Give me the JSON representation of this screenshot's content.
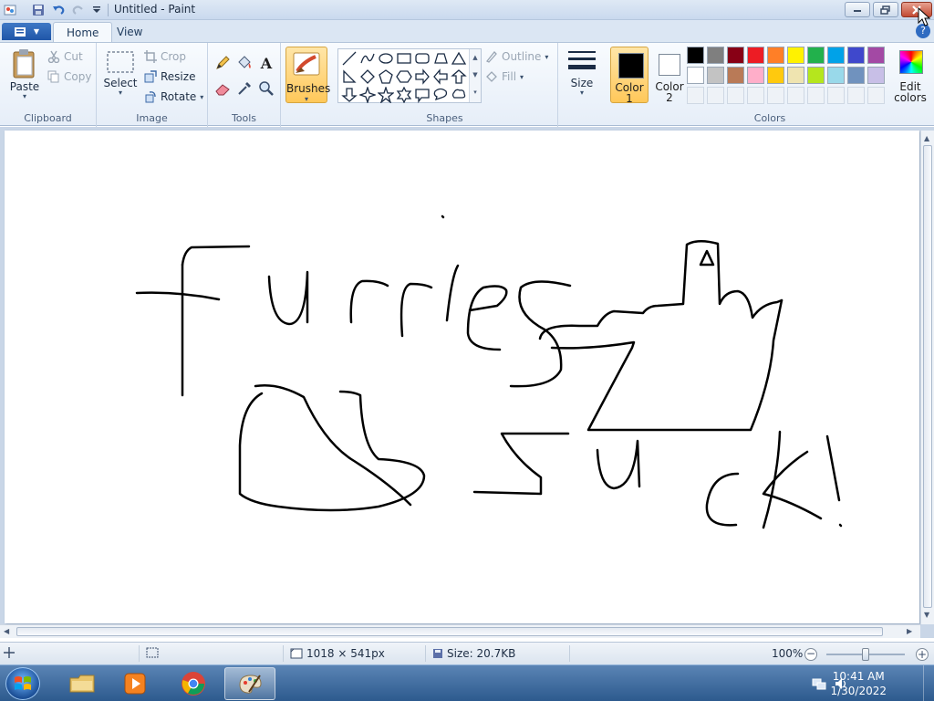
{
  "window": {
    "title": "Untitled - Paint"
  },
  "tabs": [
    {
      "label": "Home"
    },
    {
      "label": "View"
    }
  ],
  "clipboard": {
    "paste": "Paste",
    "cut": "Cut",
    "copy": "Copy",
    "group": "Clipboard"
  },
  "image": {
    "select": "Select",
    "crop": "Crop",
    "resize": "Resize",
    "rotate": "Rotate",
    "group": "Image"
  },
  "tools": {
    "group": "Tools"
  },
  "brushes": {
    "label": "Brushes"
  },
  "shapes": {
    "outline": "Outline",
    "fill": "Fill",
    "group": "Shapes"
  },
  "size": {
    "label": "Size"
  },
  "colors": {
    "color1": "Color\n1",
    "color2": "Color\n2",
    "color1_label_a": "Color",
    "color1_label_b": "1",
    "color2_label_a": "Color",
    "color2_label_b": "2",
    "edit_a": "Edit",
    "edit_b": "colors",
    "group": "Colors",
    "primary": "#000000",
    "secondary": "#ffffff",
    "palette_row1": [
      "#000000",
      "#7f7f7f",
      "#880015",
      "#ed1c24",
      "#ff7f27",
      "#fff200",
      "#22b14c",
      "#00a2e8",
      "#3f48cc",
      "#a349a4"
    ],
    "palette_row2": [
      "#ffffff",
      "#c3c3c3",
      "#b97a57",
      "#ffaec9",
      "#ffc90e",
      "#efe4b0",
      "#b5e61d",
      "#99d9ea",
      "#7092be",
      "#c8bfe7"
    ]
  },
  "status": {
    "dimensions": "1018 × 541px",
    "size": "Size: 20.7KB",
    "zoom": "100%",
    "zoom_level": 0.5
  },
  "taskbar": {
    "time": "10:41 AM",
    "date": "1/30/2022"
  }
}
